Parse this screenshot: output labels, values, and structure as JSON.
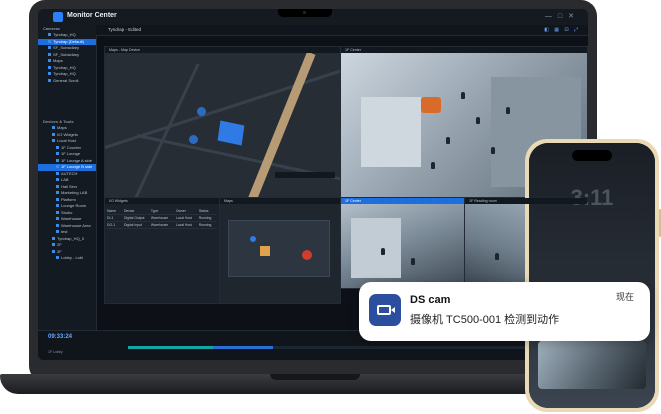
{
  "app": {
    "title": "Monitor Center"
  },
  "sidebar": {
    "section_cameras": "Cameras",
    "cameras": [
      "Tyndrap_HQ",
      "Tyndrap (Default)",
      "SF_Subsidiary",
      "SF_Subsidiary",
      "Maps",
      "Tyndrap_HQ",
      "Tyndrap_HQ",
      "General Scroll"
    ],
    "section_devices": "Devices & Tools",
    "devices": [
      "Maps",
      "I/O Widgets",
      "Local Host",
      "1F Counter",
      "1F Lounge",
      "1F Lounge A side",
      "1F Lounge B side",
      "AUTECH",
      "LAB",
      "Hall Serv",
      "Marketing LAB",
      "Platform",
      "Lounge Room",
      "Studio",
      "Warehouse",
      "Warehouse Area",
      "test",
      "Tyndrap_HQ_0",
      "2F",
      "3F",
      "Lobby - Lobi"
    ]
  },
  "tabbar": {
    "label": "Tyndrap - Edited"
  },
  "panes": {
    "map": "Maps - Map Device",
    "cam1": "1F Center",
    "list": "I/O Widgets",
    "floor": "Maps",
    "cam2": "1F Center",
    "cam3": "1F Reading room"
  },
  "io_table": {
    "headers": [
      "Name",
      "Device",
      "Type",
      "Owner",
      "Status"
    ],
    "rows": [
      [
        "DI-1",
        "Digital Output",
        "Warehouse",
        "Local Host",
        "Running"
      ],
      [
        "DO-1",
        "Digital Input",
        "Warehouse",
        "Local Host",
        "Running"
      ]
    ]
  },
  "timeline": {
    "time": "09:33:24",
    "label": "1F Lobby"
  },
  "notification": {
    "app": "DS cam",
    "time": "现在",
    "message": "摄像机 TC500-001 检测到动作"
  },
  "phone": {
    "clock": "3:11"
  }
}
